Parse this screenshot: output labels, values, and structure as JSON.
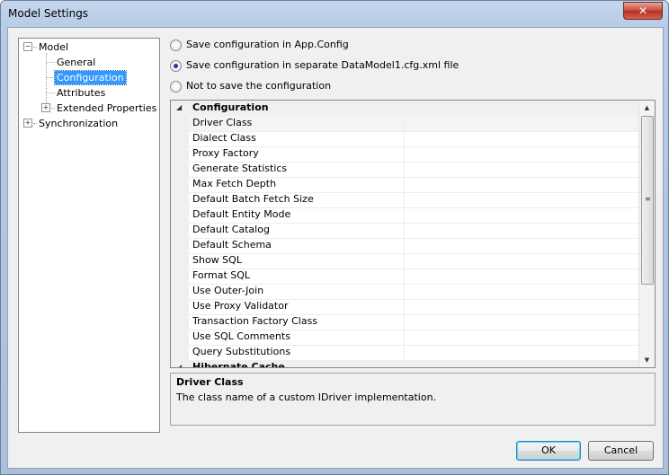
{
  "window": {
    "title": "Model Settings",
    "close_glyph": "✕"
  },
  "tree": {
    "nodes": [
      {
        "label": "Model",
        "expander": "−"
      },
      {
        "label": "General"
      },
      {
        "label": "Configuration"
      },
      {
        "label": "Attributes"
      },
      {
        "label": "Extended Properties",
        "expander": "+"
      },
      {
        "label": "Synchronization",
        "expander": "+"
      }
    ],
    "selected": "Configuration"
  },
  "options": [
    {
      "label": "Save configuration in App.Config",
      "checked": false
    },
    {
      "label": "Save configuration in separate DataModel1.cfg.xml file",
      "checked": true
    },
    {
      "label": "Not to save the configuration",
      "checked": false
    }
  ],
  "grid": {
    "category": "Configuration",
    "category2": "Hibernate Cache",
    "collapse_glyph": "◢",
    "properties": [
      "Driver Class",
      "Dialect Class",
      "Proxy Factory",
      "Generate Statistics",
      "Max Fetch Depth",
      "Default Batch Fetch Size",
      "Default Entity Mode",
      "Default Catalog",
      "Default Schema",
      "Show SQL",
      "Format SQL",
      "Use Outer-Join",
      "Use Proxy Validator",
      "Transaction Factory Class",
      "Use SQL Comments",
      "Query Substitutions"
    ],
    "scroll_up": "▲",
    "scroll_down": "▼",
    "grip": "≡"
  },
  "description": {
    "title": "Driver Class",
    "text": "The class name of a custom IDriver implementation."
  },
  "buttons": {
    "ok": "OK",
    "cancel": "Cancel"
  }
}
